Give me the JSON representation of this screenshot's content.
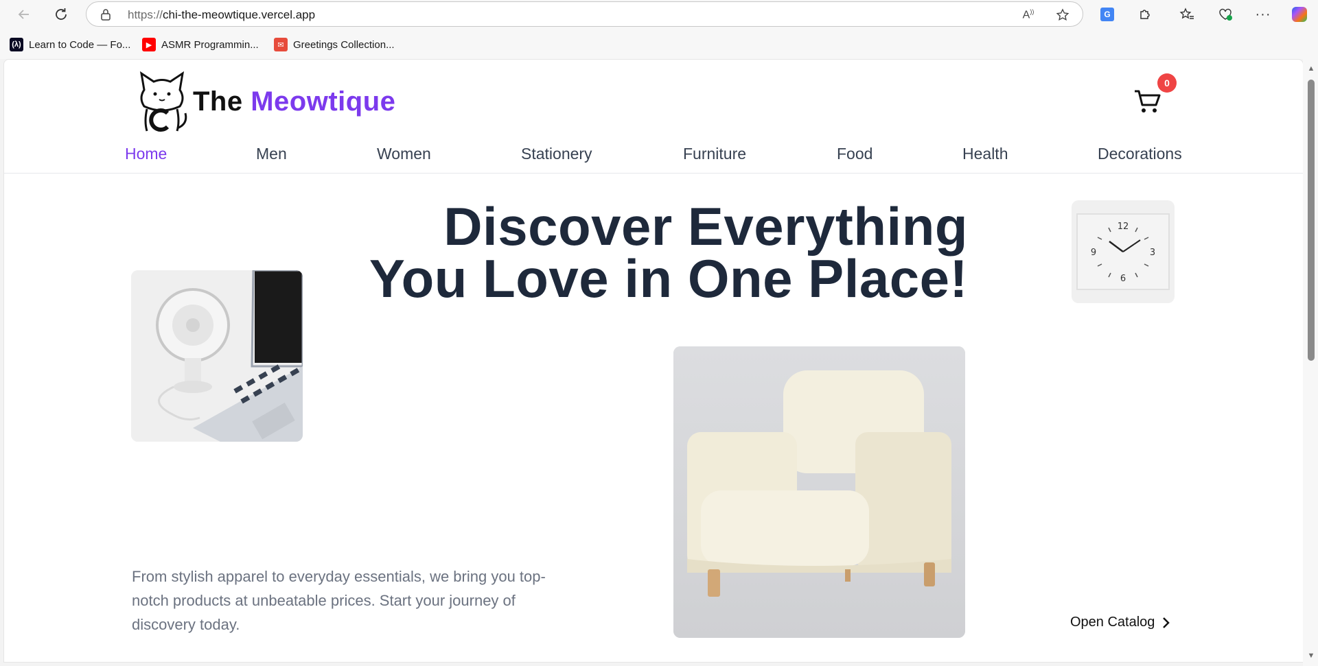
{
  "browser": {
    "url_scheme": "https://",
    "url_host": "chi-the-meowtique.vercel.app",
    "bookmarks": [
      {
        "label": "Learn to Code — Fo...",
        "icon": "freecodecamp-icon",
        "color": "#0a0a23"
      },
      {
        "label": "ASMR Programmin...",
        "icon": "youtube-icon",
        "color": "#ff0000"
      },
      {
        "label": "Greetings Collection...",
        "icon": "greetings-icon",
        "color": "#e74c3c"
      }
    ]
  },
  "site": {
    "brand_part1": "The ",
    "brand_part2": "Meowtique",
    "cart_count": "0",
    "accent_color": "#7c3aed",
    "nav": [
      {
        "label": "Home",
        "active": true
      },
      {
        "label": "Men"
      },
      {
        "label": "Women"
      },
      {
        "label": "Stationery"
      },
      {
        "label": "Furniture"
      },
      {
        "label": "Food"
      },
      {
        "label": "Health"
      },
      {
        "label": "Decorations"
      }
    ]
  },
  "hero": {
    "title_line1": "Discover Everything",
    "title_line2": "You Love in One Place!",
    "description": "From stylish apparel to everyday essentials, we bring you top-notch products at unbeatable prices. Start your journey of discovery today.",
    "cta": "Open Catalog"
  }
}
